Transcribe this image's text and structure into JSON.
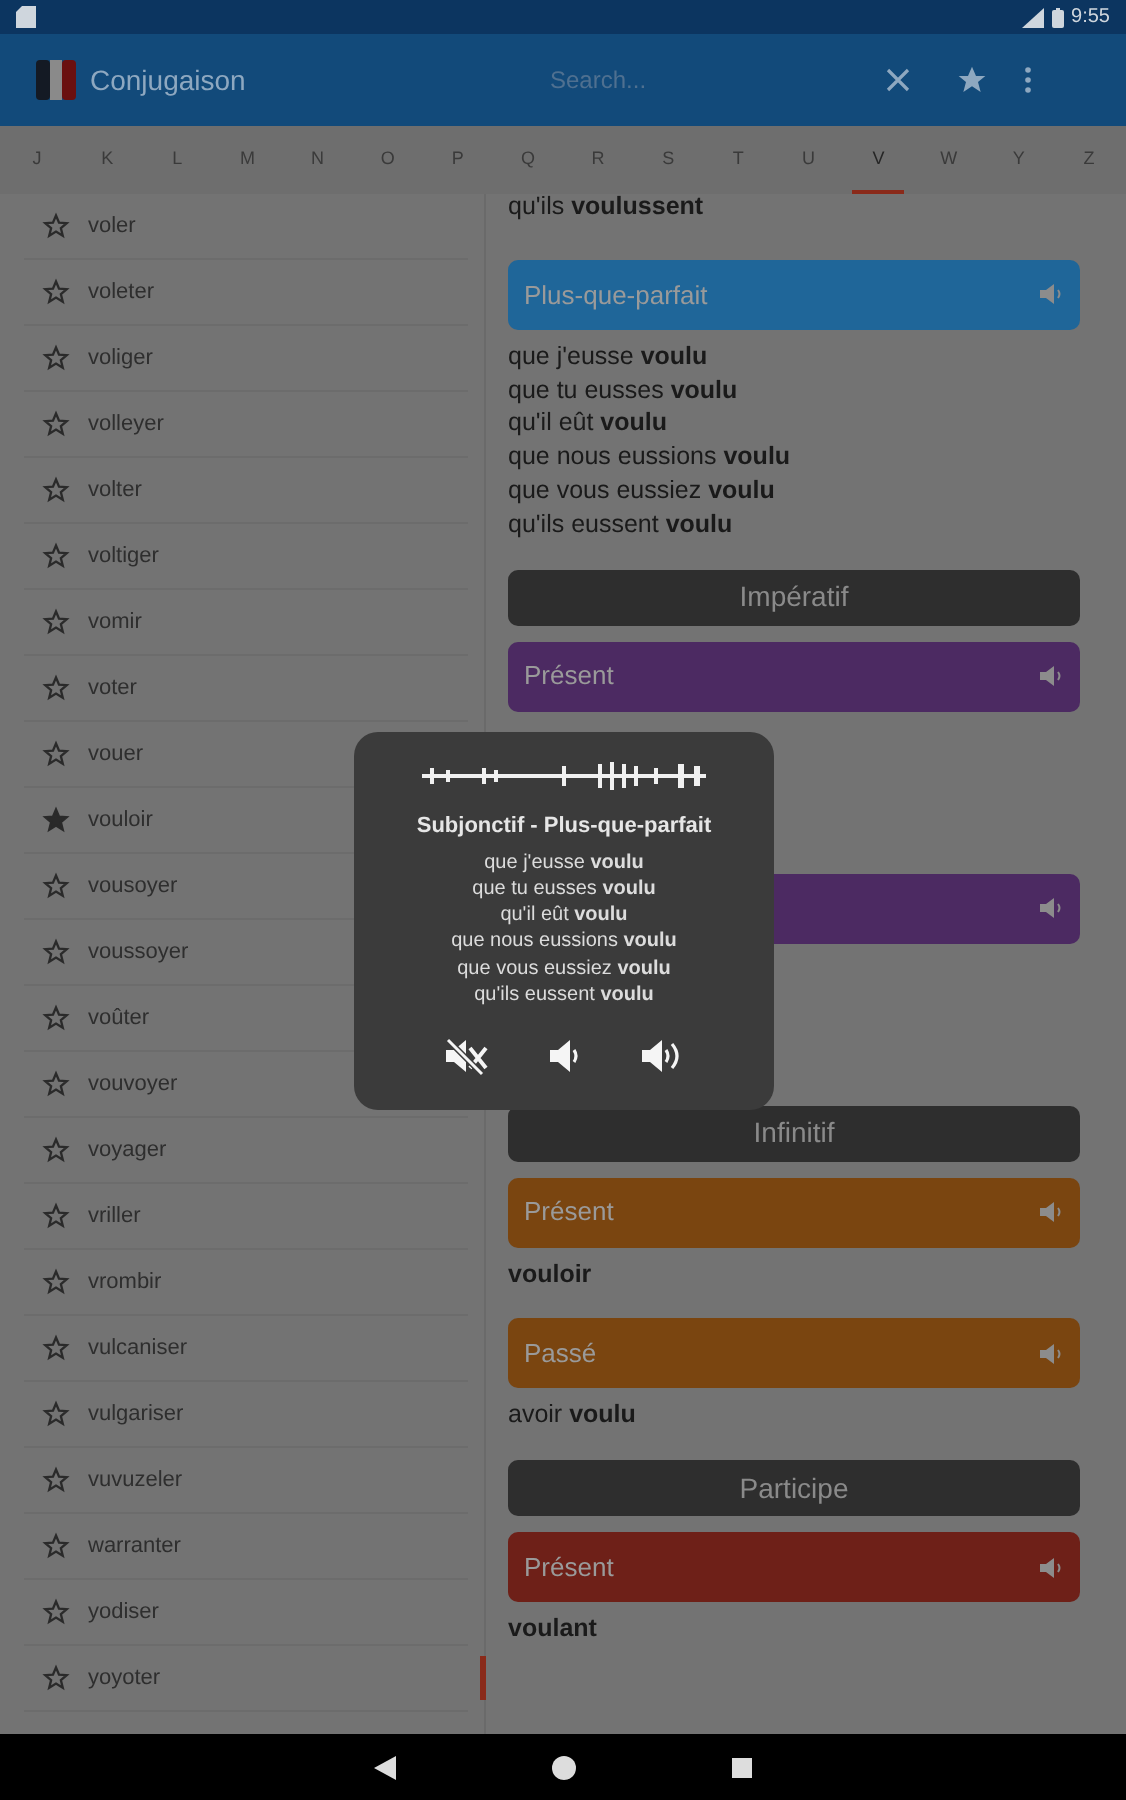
{
  "status_bar": {
    "time": "9:55"
  },
  "toolbar": {
    "title": "Conjugaison",
    "search": {
      "placeholder": "Search..."
    }
  },
  "letters": [
    {
      "label": "J",
      "selected": false
    },
    {
      "label": "K",
      "selected": false
    },
    {
      "label": "L",
      "selected": false
    },
    {
      "label": "M",
      "selected": false
    },
    {
      "label": "N",
      "selected": false
    },
    {
      "label": "O",
      "selected": false
    },
    {
      "label": "P",
      "selected": false
    },
    {
      "label": "Q",
      "selected": false
    },
    {
      "label": "R",
      "selected": false
    },
    {
      "label": "S",
      "selected": false
    },
    {
      "label": "T",
      "selected": false
    },
    {
      "label": "U",
      "selected": false
    },
    {
      "label": "V",
      "selected": true
    },
    {
      "label": "W",
      "selected": false
    },
    {
      "label": "Y",
      "selected": false
    },
    {
      "label": "Z",
      "selected": false
    }
  ],
  "verbs": [
    {
      "label": "voler",
      "favorite": false
    },
    {
      "label": "voleter",
      "favorite": false
    },
    {
      "label": "voliger",
      "favorite": false
    },
    {
      "label": "volleyer",
      "favorite": false
    },
    {
      "label": "volter",
      "favorite": false
    },
    {
      "label": "voltiger",
      "favorite": false
    },
    {
      "label": "vomir",
      "favorite": false
    },
    {
      "label": "voter",
      "favorite": false
    },
    {
      "label": "vouer",
      "favorite": false
    },
    {
      "label": "vouloir",
      "favorite": true
    },
    {
      "label": "vousoyer",
      "favorite": false
    },
    {
      "label": "voussoyer",
      "favorite": false
    },
    {
      "label": "voûter",
      "favorite": false
    },
    {
      "label": "vouvoyer",
      "favorite": false
    },
    {
      "label": "voyager",
      "favorite": false
    },
    {
      "label": "vriller",
      "favorite": false
    },
    {
      "label": "vrombir",
      "favorite": false
    },
    {
      "label": "vulcaniser",
      "favorite": false
    },
    {
      "label": "vulgariser",
      "favorite": false
    },
    {
      "label": "vuvuzeler",
      "favorite": false
    },
    {
      "label": "warranter",
      "favorite": false
    },
    {
      "label": "yodiser",
      "favorite": false
    },
    {
      "label": "yoyoter",
      "favorite": false
    }
  ],
  "conjugation": [
    {
      "kind": "lines",
      "lines": [
        "qu'ils **voulussent**"
      ]
    },
    {
      "kind": "tense",
      "label": "Plus-que-parfait",
      "color": "#1f6699"
    },
    {
      "kind": "lines",
      "lines": [
        "que j'eusse **voulu**",
        "que tu eusses **voulu**",
        "qu'il eût **voulu**",
        "que nous eussions **voulu**",
        "que vous eussiez **voulu**",
        "qu'ils eussent **voulu**"
      ]
    },
    {
      "kind": "mood",
      "label": "Impératif"
    },
    {
      "kind": "tense",
      "label": "Présent",
      "color": "#4c2a62"
    },
    {
      "kind": "tense",
      "color": "#4c2a62"
    },
    {
      "kind": "mood",
      "label": "Infinitif"
    },
    {
      "kind": "tense",
      "label": "Présent",
      "color": "#7a4510"
    },
    {
      "kind": "lines",
      "lines": [
        "**vouloir**"
      ]
    },
    {
      "kind": "tense",
      "label": "Passé",
      "color": "#7a4510"
    },
    {
      "kind": "lines",
      "lines": [
        "avoir **voulu**"
      ]
    },
    {
      "kind": "mood",
      "label": "Participe"
    },
    {
      "kind": "tense",
      "label": "Présent",
      "color": "#6e2018"
    },
    {
      "kind": "lines",
      "lines": [
        "**voulant**"
      ]
    }
  ],
  "dialog": {
    "title": "Subjonctif - Plus-que-parfait",
    "lines": [
      "que j'eusse **voulu**",
      "que tu eusses **voulu**",
      "qu'il eût **voulu**",
      "que nous eussions **voulu**",
      "que vous eussiez **voulu**",
      "qu'ils eussent **voulu**"
    ]
  }
}
